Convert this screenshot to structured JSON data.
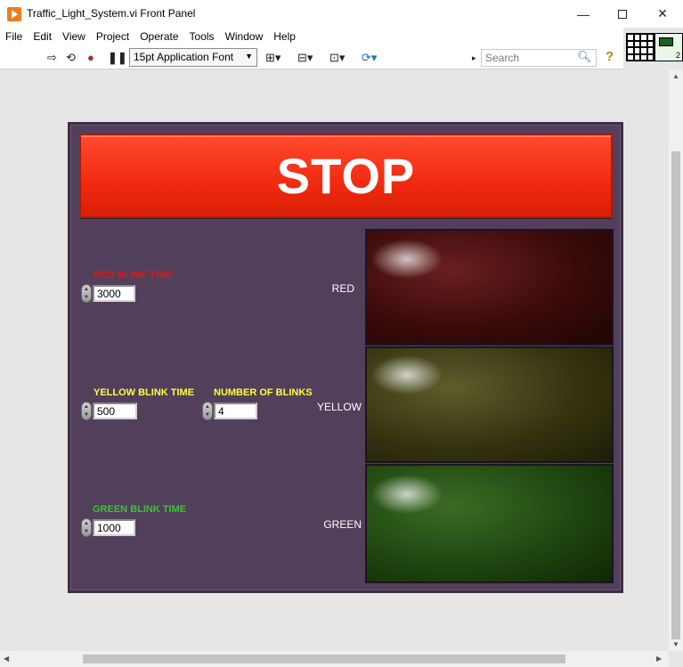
{
  "window": {
    "title": "Traffic_Light_System.vi Front Panel",
    "minimize": "—",
    "close": "✕"
  },
  "menu": [
    "File",
    "Edit",
    "View",
    "Project",
    "Operate",
    "Tools",
    "Window",
    "Help"
  ],
  "toolbar": {
    "font": "15pt Application Font",
    "search_placeholder": "Search",
    "connector_number": "2"
  },
  "panel": {
    "stop_label": "STOP",
    "red_blink_time": {
      "label": "RED BLINK TIME",
      "value": "3000",
      "color": "#d81a1a"
    },
    "yellow_blink_time": {
      "label": "YELLOW BLINK TIME",
      "value": "500",
      "color": "#ffff3a"
    },
    "number_of_blinks": {
      "label": "NUMBER OF BLINKS",
      "value": "4",
      "color": "#ffff3a"
    },
    "green_blink_time": {
      "label": "GREEN BLINK TIME",
      "value": "1000",
      "color": "#3ec03e"
    },
    "lights": {
      "red": {
        "label": "RED",
        "state": "off"
      },
      "yellow": {
        "label": "YELLOW",
        "state": "off"
      },
      "green": {
        "label": "GREEN",
        "state": "off"
      }
    }
  }
}
